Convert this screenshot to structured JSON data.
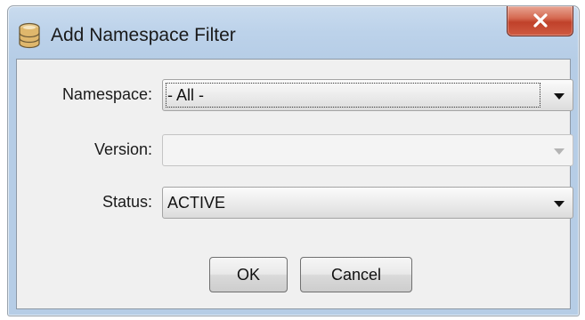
{
  "window": {
    "title": "Add Namespace Filter",
    "title_icon": "database-icon",
    "close_icon": "close-x-icon"
  },
  "form": {
    "namespace": {
      "label": "Namespace:",
      "value": "- All -",
      "enabled": true,
      "focused": true
    },
    "version": {
      "label": "Version:",
      "value": "",
      "enabled": false
    },
    "status": {
      "label": "Status:",
      "value": "ACTIVE",
      "enabled": true
    }
  },
  "buttons": {
    "ok_label": "OK",
    "cancel_label": "Cancel"
  },
  "colors": {
    "close_button": "#c7482f",
    "titlebar": "#bcd2ea",
    "client_background": "#f0f0f0"
  }
}
